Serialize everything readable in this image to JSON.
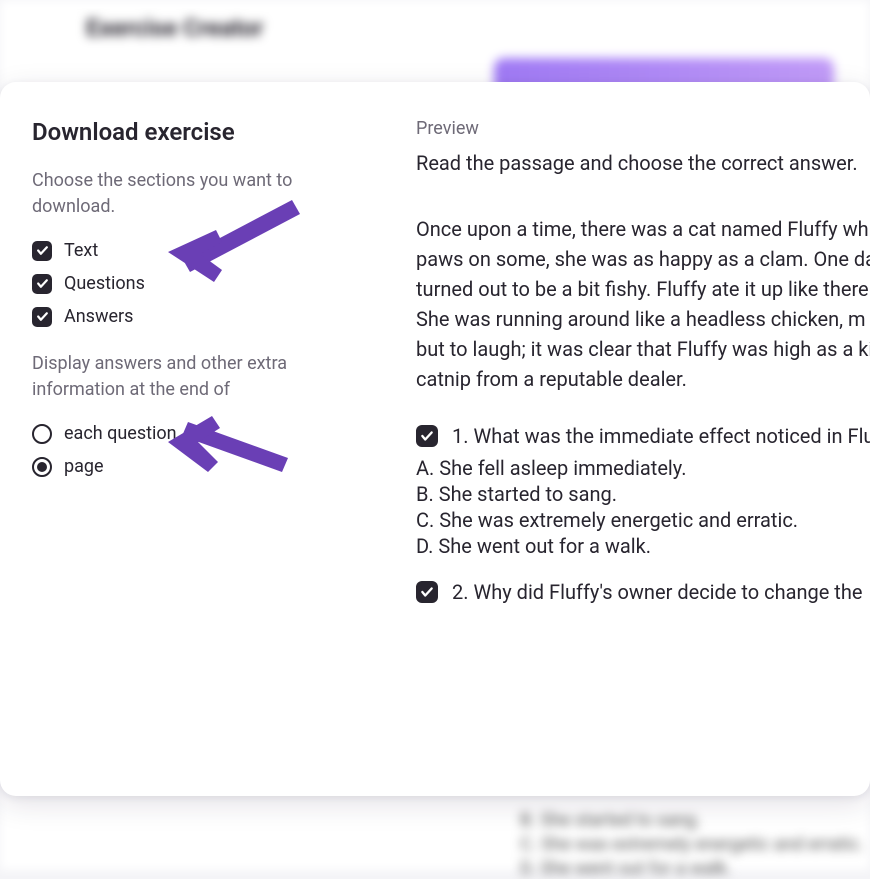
{
  "background": {
    "page_title": "Exercise Creator"
  },
  "modal": {
    "title": "Download exercise",
    "choose_label": "Choose the sections you want to download.",
    "checkboxes": {
      "text": "Text",
      "questions": "Questions",
      "answers": "Answers"
    },
    "display_label": "Display answers and other extra information at the end of",
    "radios": {
      "each_question": "each question",
      "page": "page"
    }
  },
  "preview": {
    "label": "Preview",
    "instruction": "Read the passage and choose the correct answer.",
    "passage_lines": [
      "Once upon a time, there was a cat named Fluffy wh",
      "paws on some, she was as happy as a clam. One da",
      "turned out to be a bit fishy. Fluffy ate it up like there",
      "She was running around like a headless chicken, m",
      "but to laugh; it was clear that Fluffy was high as a kite",
      "catnip from a reputable dealer."
    ],
    "q1": {
      "text": "1. What was the immediate effect noticed in Flu",
      "a": "A. She fell asleep immediately.",
      "b": "B. She started to sang.",
      "c": "C. She was extremely energetic and erratic.",
      "d": "D. She went out for a walk."
    },
    "q2": {
      "text": "2. Why did Fluffy's owner decide to change the"
    }
  }
}
